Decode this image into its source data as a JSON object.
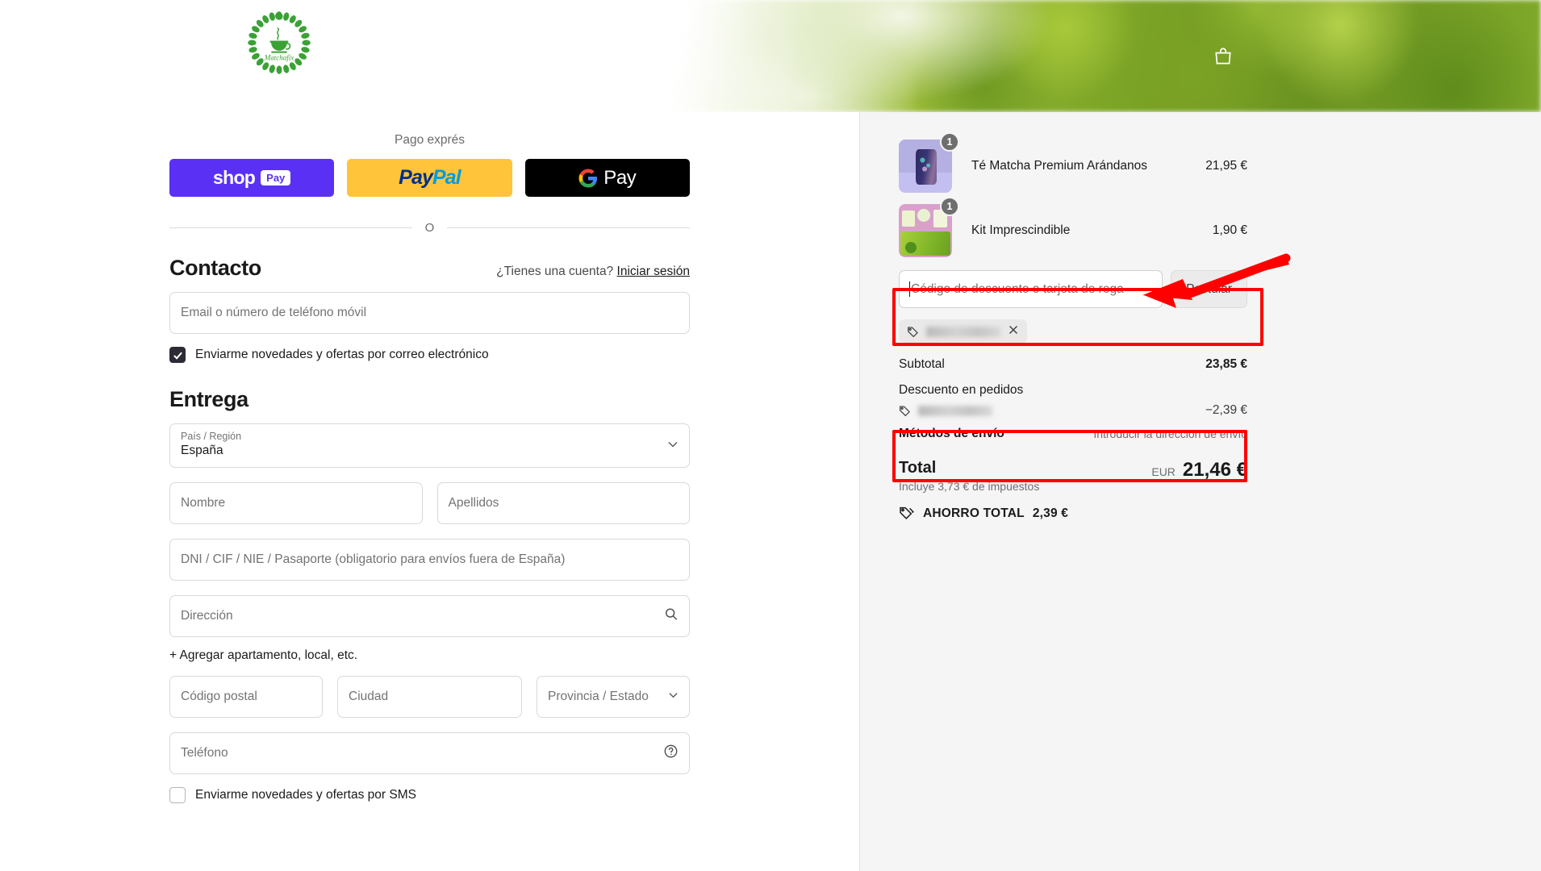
{
  "header": {
    "logo_name": "Matchafix",
    "cart_icon": "shopping-bag-icon"
  },
  "express": {
    "label": "Pago exprés",
    "buttons": [
      {
        "name": "shop-pay",
        "word": "shop",
        "pill": "Pay",
        "bg": "#5A31F4"
      },
      {
        "name": "paypal",
        "part_a": "Pay",
        "part_b": "Pal",
        "bg": "#FFC439"
      },
      {
        "name": "google-pay",
        "word": "Pay",
        "bg": "#000000"
      }
    ],
    "divider_text": "O"
  },
  "contact": {
    "heading": "Contacto",
    "account_question": "¿Tienes una cuenta?",
    "login_link": "Iniciar sesión",
    "email_placeholder": "Email o número de teléfono móvil",
    "newsletter_label": "Enviarme novedades y ofertas por correo electrónico",
    "newsletter_checked": true
  },
  "delivery": {
    "heading": "Entrega",
    "country_label": "País / Región",
    "country_value": "España",
    "first_name_placeholder": "Nombre",
    "last_name_placeholder": "Apellidos",
    "id_placeholder": "DNI / CIF / NIE / Pasaporte (obligatorio para envíos fuera de España)",
    "address_placeholder": "Dirección",
    "add_apartment": "+ Agregar apartamento, local, etc.",
    "postal_placeholder": "Código postal",
    "city_placeholder": "Ciudad",
    "province_placeholder": "Provincia / Estado",
    "phone_placeholder": "Teléfono",
    "sms_label": "Enviarme novedades y ofertas por SMS",
    "sms_checked": false
  },
  "summary": {
    "items": [
      {
        "name": "Té Matcha Premium Arándanos",
        "qty": "1",
        "price": "21,95 €"
      },
      {
        "name": "Kit Imprescindible",
        "qty": "1",
        "price": "1,90 €"
      }
    ],
    "discount_placeholder": "Código de descuento o tarjeta de rega",
    "apply_button": "Postular",
    "applied_code_blurred": true,
    "subtotal_label": "Subtotal",
    "subtotal_value": "23,85 €",
    "order_discount_label": "Descuento en pedidos",
    "order_discount_value": "−2,39 €",
    "shipping_label": "Métodos de envío",
    "shipping_note": "Introducir la dirección de envío",
    "total_label": "Total",
    "tax_note": "Incluye 3,73 € de impuestos",
    "currency": "EUR",
    "total_value": "21,46 €",
    "savings_label": "AHORRO TOTAL",
    "savings_value": "2,39 €"
  },
  "annotations": {
    "color": "#FF0000",
    "boxes": [
      "discount-code-field",
      "order-discount-line"
    ],
    "arrow_target": "discount-code-field"
  }
}
